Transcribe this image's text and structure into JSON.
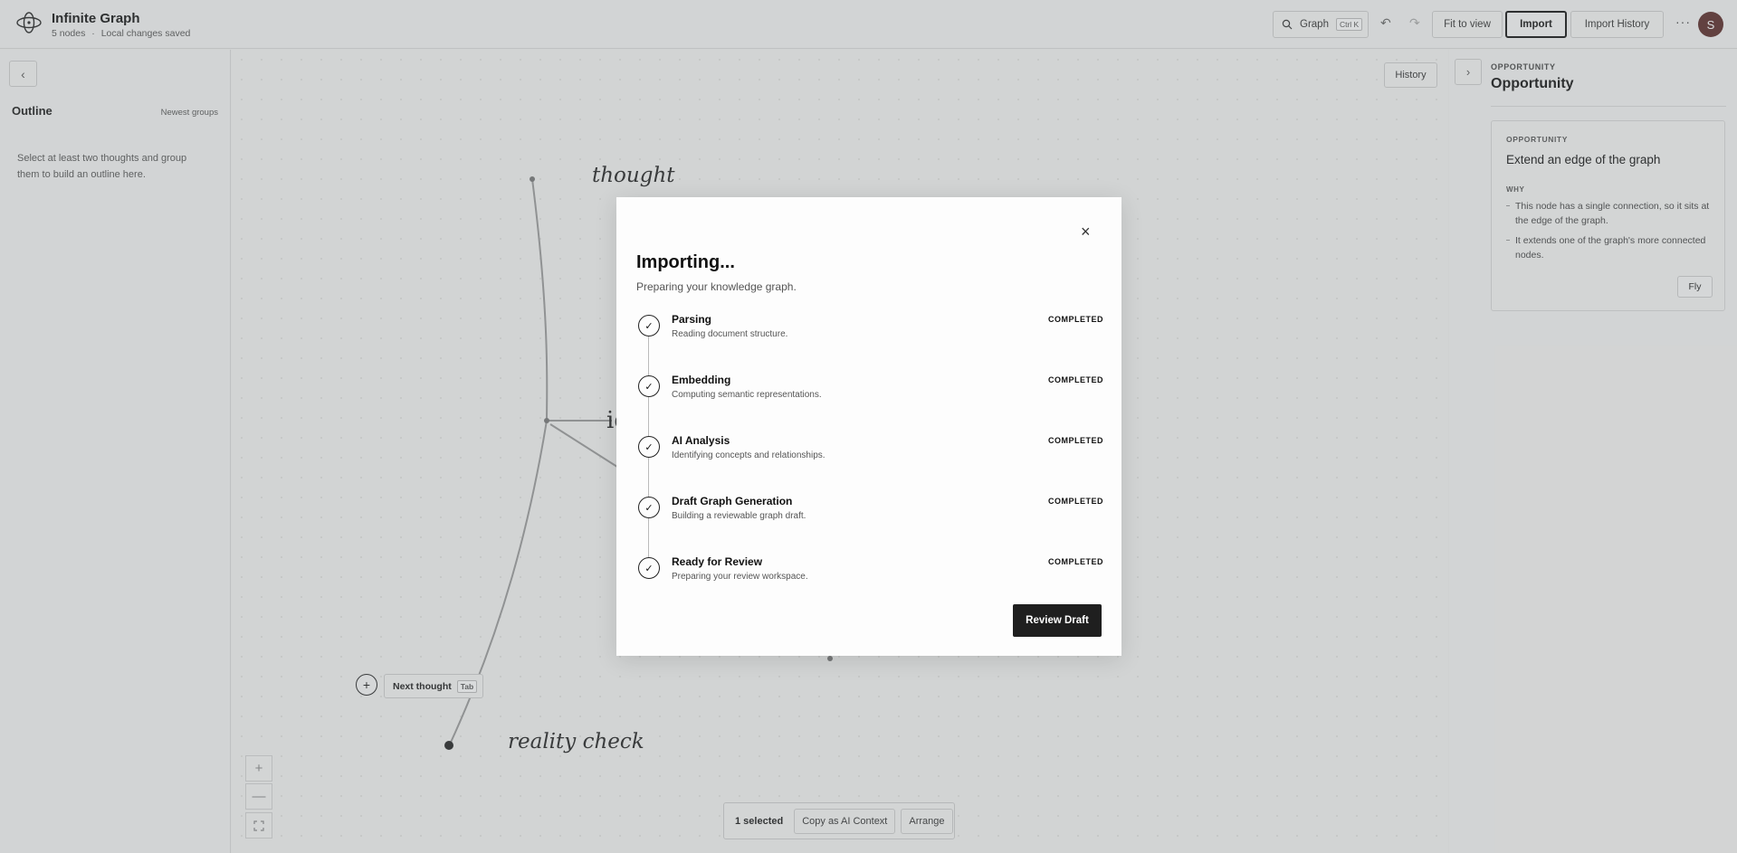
{
  "app": {
    "title": "Infinite Graph",
    "node_count": "5 nodes",
    "separator": "·",
    "save_status": "Local changes saved"
  },
  "toolbar": {
    "search_label": "Graph",
    "search_shortcut": "Ctrl K",
    "undo_icon": "undo-icon",
    "redo_icon": "redo-icon",
    "fit_label": "Fit to view",
    "import_label": "Import",
    "import_history_label": "Import History",
    "more_label": "···",
    "avatar_initial": "S"
  },
  "outline": {
    "collapse_label": "‹",
    "title": "Outline",
    "sort_label": "Newest groups",
    "empty_text": "Select at least two thoughts and group them to build an outline here."
  },
  "canvas": {
    "history_label": "History",
    "nodes": [
      {
        "label": "thought"
      },
      {
        "label": "id"
      },
      {
        "label": "reality check"
      }
    ],
    "next_thought_label": "Next thought",
    "next_thought_shortcut": "Tab",
    "add_label": "+",
    "zoom_in_label": "+",
    "zoom_out_label": "—",
    "fit_icon": "fullscreen-icon"
  },
  "selection_bar": {
    "count": "1 selected",
    "copy_label": "Copy as AI Context",
    "arrange_label": "Arrange"
  },
  "modal": {
    "close_label": "×",
    "title": "Importing...",
    "subtitle": "Preparing your knowledge graph.",
    "steps": [
      {
        "name": "Parsing",
        "desc": "Reading document structure.",
        "status": "COMPLETED"
      },
      {
        "name": "Embedding",
        "desc": "Computing semantic representations.",
        "status": "COMPLETED"
      },
      {
        "name": "AI Analysis",
        "desc": "Identifying concepts and relationships.",
        "status": "COMPLETED"
      },
      {
        "name": "Draft Graph Generation",
        "desc": "Building a reviewable graph draft.",
        "status": "COMPLETED"
      },
      {
        "name": "Ready for Review",
        "desc": "Preparing your review workspace.",
        "status": "COMPLETED"
      }
    ],
    "check_glyph": "✓",
    "review_label": "Review Draft"
  },
  "right_panel": {
    "collapse_label": "›",
    "eyebrow": "OPPORTUNITY",
    "title": "Opportunity",
    "card": {
      "eyebrow": "OPPORTUNITY",
      "title": "Extend an edge of the graph",
      "why_label": "WHY",
      "reasons": [
        "This node has a single connection, so it sits at the edge of the graph.",
        "It extends one of the graph's more connected nodes."
      ],
      "fly_label": "Fly"
    }
  },
  "colors": {
    "accent_dark": "#1f1f1f",
    "avatar_bg": "#5a2a28",
    "background": "#f3f3f2"
  }
}
